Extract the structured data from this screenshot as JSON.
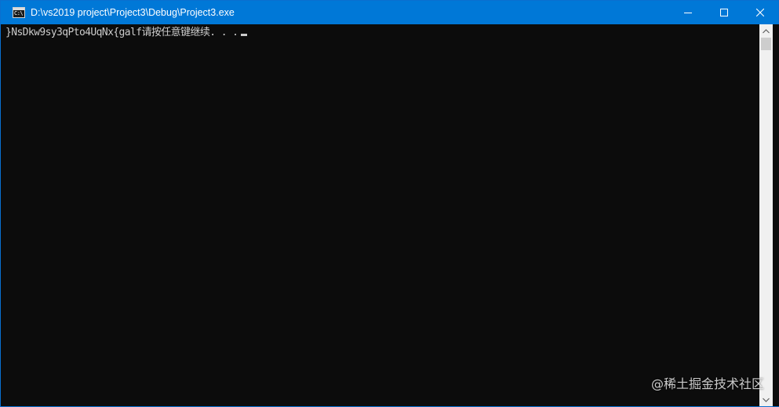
{
  "window": {
    "title": "D:\\vs2019 project\\Project3\\Debug\\Project3.exe",
    "icon": "console-app-icon",
    "icon_text": "C:\\",
    "accent_color": "#0078d7"
  },
  "caption_buttons": {
    "minimize": "minimize-icon",
    "maximize": "maximize-icon",
    "close": "close-icon"
  },
  "console": {
    "background": "#0c0c0c",
    "foreground": "#cccccc",
    "output": "}NsDkw9sy3qPto4UqNx{galf请按任意键继续. . ."
  },
  "scrollbar": {
    "up": "scroll-up-arrow-icon",
    "down": "scroll-down-arrow-icon"
  },
  "watermark": {
    "text": "@稀土掘金技术社区"
  }
}
